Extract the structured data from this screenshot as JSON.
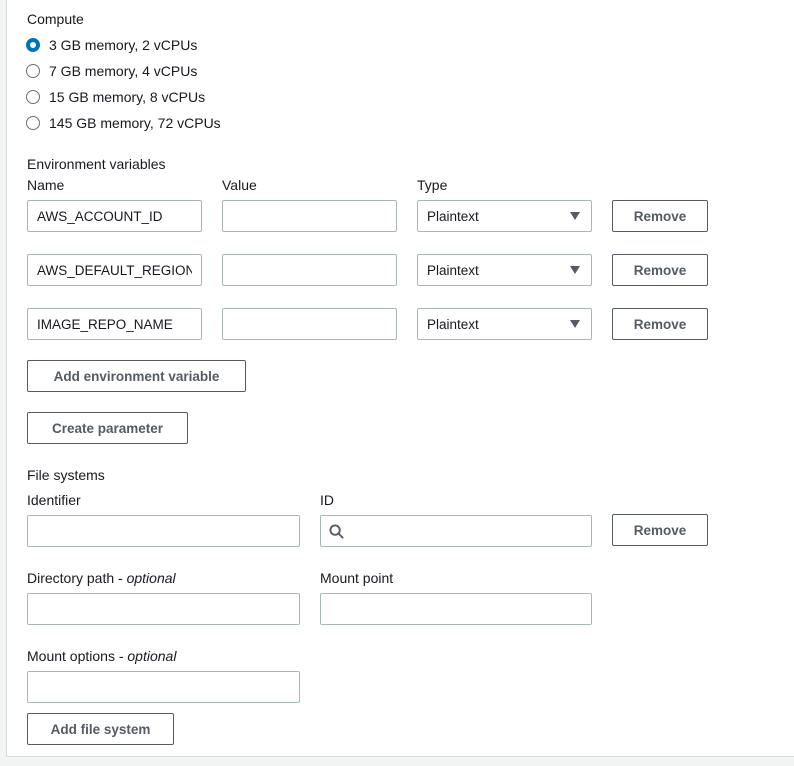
{
  "compute": {
    "title": "Compute",
    "options": [
      {
        "label": "3 GB memory, 2 vCPUs",
        "selected": true
      },
      {
        "label": "7 GB memory, 4 vCPUs",
        "selected": false
      },
      {
        "label": "15 GB memory, 8 vCPUs",
        "selected": false
      },
      {
        "label": "145 GB memory, 72 vCPUs",
        "selected": false
      }
    ]
  },
  "env": {
    "title": "Environment variables",
    "col_name": "Name",
    "col_value": "Value",
    "col_type": "Type",
    "rows": [
      {
        "name": "AWS_ACCOUNT_ID",
        "value": "",
        "type": "Plaintext",
        "remove": "Remove"
      },
      {
        "name": "AWS_DEFAULT_REGION",
        "value": "",
        "type": "Plaintext",
        "remove": "Remove"
      },
      {
        "name": "IMAGE_REPO_NAME",
        "value": "",
        "type": "Plaintext",
        "remove": "Remove"
      }
    ],
    "add_label": "Add environment variable",
    "create_param_label": "Create parameter"
  },
  "fs": {
    "title": "File systems",
    "identifier_label": "Identifier",
    "identifier_value": "",
    "id_label": "ID",
    "id_value": "",
    "remove_label": "Remove",
    "dir_label": "Directory path - ",
    "dir_optional": "optional",
    "dir_value": "",
    "mount_point_label": "Mount point",
    "mount_point_value": "",
    "mount_opts_label": "Mount options - ",
    "mount_opts_optional": "optional",
    "mount_opts_value": "",
    "add_label": "Add file system"
  },
  "colors": {
    "accent": "#0073bb",
    "border": "#aab7b8",
    "button_text": "#545b64"
  }
}
